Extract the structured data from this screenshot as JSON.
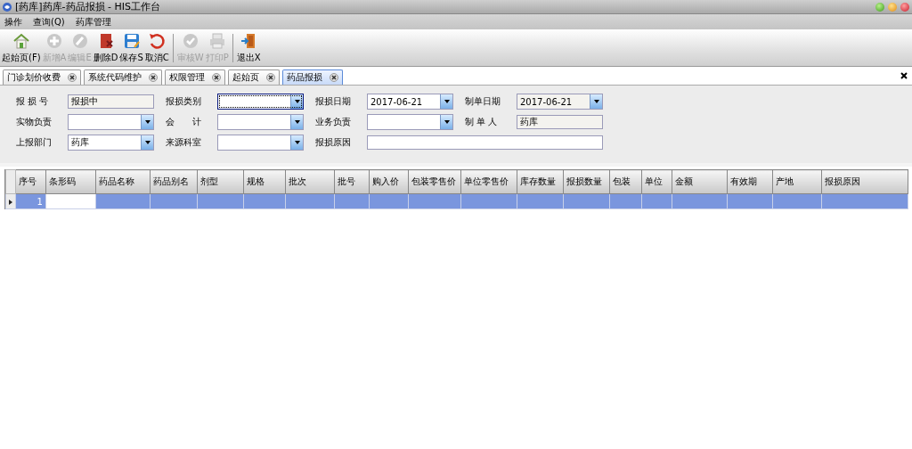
{
  "window": {
    "title": "[药库]药库-药品报损 - HIS工作台"
  },
  "menu": [
    "操作",
    "查询(Q)",
    "药库管理"
  ],
  "toolbar": [
    {
      "label": "起始页(F)",
      "kind": "home",
      "disabled": false
    },
    {
      "label": "新增A",
      "kind": "add",
      "disabled": true
    },
    {
      "label": "编辑E",
      "kind": "edit",
      "disabled": true
    },
    {
      "label": "删除D",
      "kind": "delete",
      "disabled": false
    },
    {
      "label": "保存S",
      "kind": "save",
      "disabled": false
    },
    {
      "label": "取消C",
      "kind": "undo",
      "disabled": false,
      "sep_after": true
    },
    {
      "label": "审核W",
      "kind": "check",
      "disabled": true
    },
    {
      "label": "打印P",
      "kind": "print",
      "disabled": true,
      "sep_after": true
    },
    {
      "label": "退出X",
      "kind": "exit",
      "disabled": false
    }
  ],
  "tabs": [
    {
      "label": "门诊划价收费",
      "selected": false
    },
    {
      "label": "系统代码维护",
      "selected": false
    },
    {
      "label": "权限管理",
      "selected": false
    },
    {
      "label": "起始页",
      "selected": false
    },
    {
      "label": "药品报损",
      "selected": true
    }
  ],
  "form": [
    {
      "label": "报 损 号",
      "kind": "text",
      "value": "报损中",
      "readonly": true
    },
    {
      "label": "报损类别",
      "kind": "combo",
      "focused": true
    },
    {
      "label": "报损日期",
      "kind": "combo",
      "value": "2017-06-21"
    },
    {
      "label": "制单日期",
      "kind": "combo",
      "value": "2017-06-21",
      "readonly": true
    },
    {
      "label": "实物负责",
      "kind": "combo"
    },
    {
      "label": "会　　计",
      "kind": "combo"
    },
    {
      "label": "业务负责",
      "kind": "combo"
    },
    {
      "label": "制 单 人",
      "kind": "text",
      "value": "药库",
      "readonly": true
    },
    {
      "label": "上报部门",
      "kind": "combo",
      "value": "药库"
    },
    {
      "label": "来源科室",
      "kind": "combo"
    },
    {
      "label": "报损原因",
      "kind": "wide"
    }
  ],
  "table": {
    "columns": [
      "序号",
      "条形码",
      "药品名称",
      "药品别名",
      "剂型",
      "规格",
      "批次",
      "批号",
      "购入价",
      "包装零售价",
      "单位零售价",
      "库存数量",
      "报损数量",
      "包装",
      "单位",
      "金额",
      "有效期",
      "产地",
      "报损原因"
    ],
    "rows": [
      {
        "index": "1",
        "selected": true
      }
    ]
  }
}
